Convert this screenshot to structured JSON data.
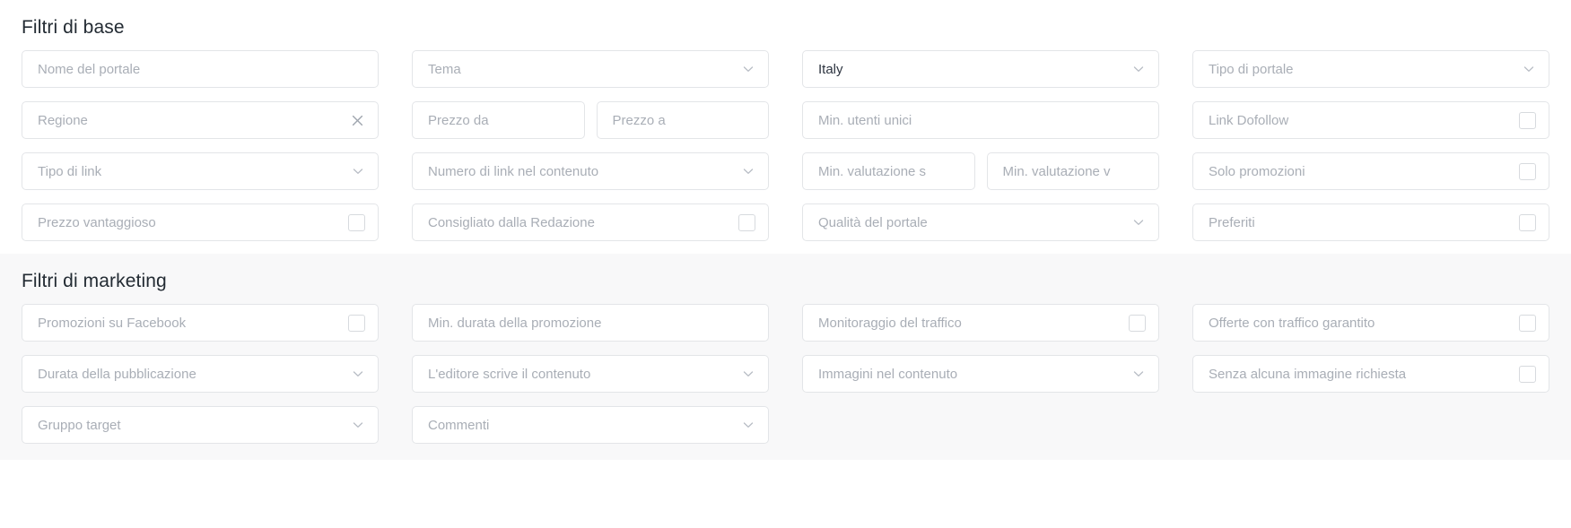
{
  "sections": [
    {
      "id": "base",
      "title": "Filtri di base",
      "rows": [
        [
          {
            "kind": "text",
            "label": "Nome del portale",
            "name": "portal-name-input"
          },
          {
            "kind": "select",
            "label": "Tema",
            "name": "theme-select"
          },
          {
            "kind": "select",
            "label": "Italy",
            "filled": true,
            "name": "country-select"
          },
          {
            "kind": "select",
            "label": "Tipo di portale",
            "name": "portal-type-select"
          }
        ],
        [
          {
            "kind": "clear",
            "label": "Regione",
            "name": "region-input"
          },
          {
            "kind": "split",
            "fields": [
              {
                "kind": "text",
                "label": "Prezzo da",
                "name": "price-from-input"
              },
              {
                "kind": "text",
                "label": "Prezzo a",
                "name": "price-to-input"
              }
            ]
          },
          {
            "kind": "text",
            "label": "Min. utenti unici",
            "name": "min-unique-users-input"
          },
          {
            "kind": "checkbox",
            "label": "Link Dofollow",
            "name": "dofollow-link-checkbox"
          }
        ],
        [
          {
            "kind": "select",
            "label": "Tipo di link",
            "name": "link-type-select"
          },
          {
            "kind": "select",
            "label": "Numero di link nel contenuto",
            "name": "links-in-content-select"
          },
          {
            "kind": "split",
            "fields": [
              {
                "kind": "text",
                "label": "Min. valutazione s",
                "name": "min-rating-s-input"
              },
              {
                "kind": "text",
                "label": "Min. valutazione v",
                "name": "min-rating-v-input"
              }
            ]
          },
          {
            "kind": "checkbox",
            "label": "Solo promozioni",
            "name": "only-promotions-checkbox"
          }
        ],
        [
          {
            "kind": "checkbox",
            "label": "Prezzo vantaggioso",
            "name": "good-price-checkbox"
          },
          {
            "kind": "checkbox",
            "label": "Consigliato dalla Redazione",
            "name": "editors-choice-checkbox"
          },
          {
            "kind": "select",
            "label": "Qualità del portale",
            "name": "portal-quality-select"
          },
          {
            "kind": "checkbox",
            "label": "Preferiti",
            "name": "favorites-checkbox"
          }
        ]
      ]
    },
    {
      "id": "marketing",
      "title": "Filtri di marketing",
      "rows": [
        [
          {
            "kind": "checkbox",
            "label": "Promozioni su Facebook",
            "name": "facebook-promotions-checkbox"
          },
          {
            "kind": "text",
            "label": "Min. durata della promozione",
            "name": "min-promotion-duration-input"
          },
          {
            "kind": "checkbox",
            "label": "Monitoraggio del traffico",
            "name": "traffic-monitoring-checkbox"
          },
          {
            "kind": "checkbox",
            "label": "Offerte con traffico garantito",
            "name": "guaranteed-traffic-checkbox"
          }
        ],
        [
          {
            "kind": "select",
            "label": "Durata della pubblicazione",
            "name": "publication-duration-select"
          },
          {
            "kind": "select",
            "label": "L'editore scrive il contenuto",
            "name": "publisher-writes-content-select"
          },
          {
            "kind": "select",
            "label": "Immagini nel contenuto",
            "name": "images-in-content-select"
          },
          {
            "kind": "checkbox",
            "label": "Senza alcuna immagine richiesta",
            "name": "no-image-required-checkbox"
          }
        ],
        [
          {
            "kind": "select",
            "label": "Gruppo target",
            "name": "target-group-select"
          },
          {
            "kind": "select",
            "label": "Commenti",
            "name": "comments-select"
          },
          {
            "kind": "empty"
          },
          {
            "kind": "empty"
          }
        ]
      ]
    }
  ],
  "icons": {
    "chevron_down": "chevron-down-icon",
    "clear": "close-icon",
    "checkbox": "checkbox-icon"
  },
  "colors": {
    "placeholder": "#a9aeb6",
    "value": "#2d3440",
    "border": "#e3e5e8",
    "heading": "#232b33",
    "marketing_bg": "#f8f8f9",
    "page_bg": "#ffffff"
  }
}
